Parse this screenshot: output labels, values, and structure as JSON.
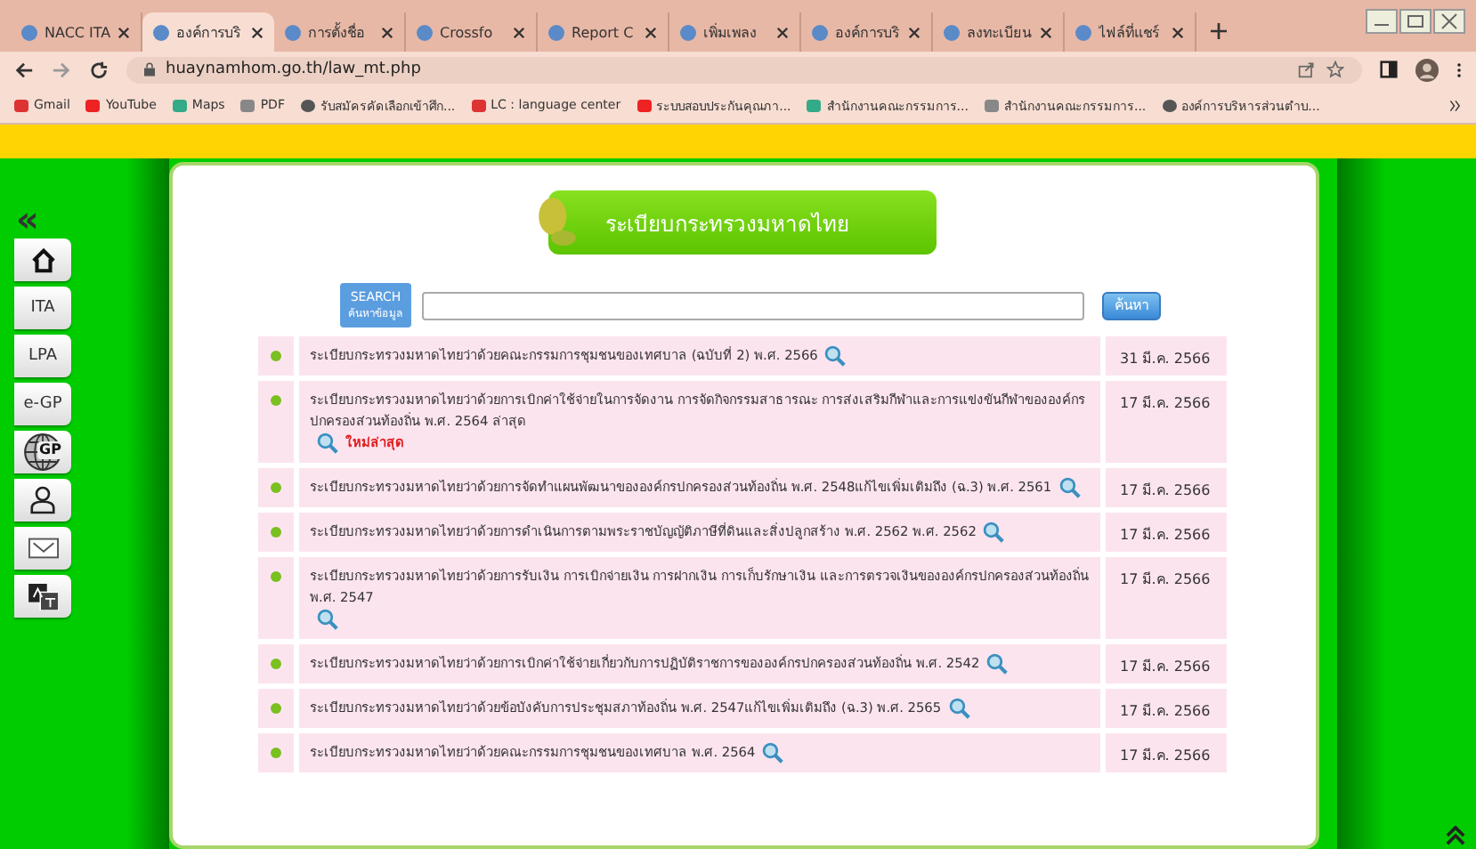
{
  "tabs": [
    {
      "title": "NACC ITA",
      "selected": false
    },
    {
      "title": "องค์การบริ",
      "selected": true
    },
    {
      "title": "การตั้งชื่อ",
      "selected": false
    },
    {
      "title": "Crossfo",
      "selected": false
    },
    {
      "title": "Report C",
      "selected": false
    },
    {
      "title": "เพิ่มเพลง",
      "selected": false
    },
    {
      "title": "องค์การบริ",
      "selected": false
    },
    {
      "title": "ลงทะเบียน",
      "selected": false
    },
    {
      "title": "ไฟล์ที่แชร์",
      "selected": false
    }
  ],
  "address_bar": {
    "url": "huaynamhom.go.th/law_mt.php"
  },
  "bookmarks": [
    {
      "label": "Gmail"
    },
    {
      "label": "YouTube"
    },
    {
      "label": "Maps"
    },
    {
      "label": "PDF"
    },
    {
      "label": "รับสมัครคัดเลือกเข้าศึก..."
    },
    {
      "label": "LC : language center"
    },
    {
      "label": "ระบบสอบประกันคุณภา..."
    },
    {
      "label": "สำนักงานคณะกรรมการ..."
    },
    {
      "label": "สำนักงานคณะกรรมการ..."
    },
    {
      "label": "องค์การบริหารส่วนตำบ..."
    }
  ],
  "sidebar": {
    "collapse": "«",
    "items": [
      {
        "kind": "home"
      },
      {
        "kind": "text",
        "label": "ITA"
      },
      {
        "kind": "text",
        "label": "LPA"
      },
      {
        "kind": "text",
        "label": "e-GP"
      },
      {
        "kind": "globe",
        "label": "GP"
      },
      {
        "kind": "person"
      },
      {
        "kind": "mail"
      },
      {
        "kind": "translate"
      }
    ]
  },
  "banner": {
    "title": "ระเบียบกระทรวงมหาดไทย"
  },
  "search": {
    "label_top": "SEARCH",
    "label_bottom": "ค้นหาข้อมูล",
    "button": "ค้นหา"
  },
  "rows": [
    {
      "title": "ระเบียบกระทรวงมหาดไทยว่าด้วยคณะกรรมการชุมชนของเทศบาล (ฉบับที่ 2) พ.ศ. 2566",
      "date": "31 มี.ค. 2566"
    },
    {
      "title": "ระเบียบกระทรวงมหาดไทยว่าด้วยการเบิกค่าใช้จ่ายในการจัดงาน การจัดกิจกรรมสาธารณะ การส่งเสริมกีฬาและการแข่งขันกีฬาขององค์กรปกครองส่วนท้องถิ่น พ.ศ. 2564 ล่าสุด",
      "badge": "ใหม่ล่าสุด",
      "date": "17 มี.ค. 2566"
    },
    {
      "title": "ระเบียบกระทรวงมหาดไทยว่าด้วยการจัดทำแผนพัฒนาขององค์กรปกครองส่วนท้องถิ่น พ.ศ. 2548แก้ไขเพิ่มเติมถึง (ฉ.3) พ.ศ. 2561",
      "date": "17 มี.ค. 2566"
    },
    {
      "title": "ระเบียบกระทรวงมหาดไทยว่าด้วยการดำเนินการตามพระราชบัญญัติภาษีที่ดินและสิ่งปลูกสร้าง พ.ศ. 2562 พ.ศ. 2562",
      "date": "17 มี.ค. 2566"
    },
    {
      "title": "ระเบียบกระทรวงมหาดไทยว่าด้วยการรับเงิน การเบิกจ่ายเงิน การฝากเงิน การเก็บรักษาเงิน และการตรวจเงินขององค์กรปกครองส่วนท้องถิ่น พ.ศ. 2547",
      "date": "17 มี.ค. 2566"
    },
    {
      "title": "ระเบียบกระทรวงมหาดไทยว่าด้วยการเบิกค่าใช้จ่ายเกี่ยวกับการปฏิบัติราชการขององค์กรปกครองส่วนท้องถิ่น พ.ศ. 2542",
      "date": "17 มี.ค. 2566"
    },
    {
      "title": "ระเบียบกระทรวงมหาดไทยว่าด้วยข้อบังคับการประชุมสภาท้องถิ่น พ.ศ. 2547แก้ไขเพิ่มเติมถึง (ฉ.3) พ.ศ. 2565",
      "date": "17 มี.ค. 2566"
    },
    {
      "title": "ระเบียบกระทรวงมหาดไทยว่าด้วยคณะกรรมการชุมชนของเทศบาล พ.ศ. 2564",
      "date": "17 มี.ค. 2566"
    }
  ]
}
